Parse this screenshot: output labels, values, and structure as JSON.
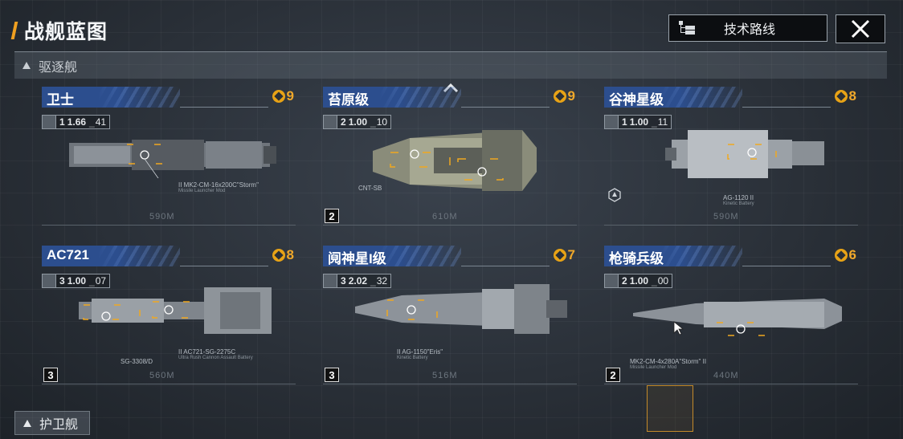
{
  "header": {
    "title": "战舰蓝图",
    "tech_route_label": "技术路线"
  },
  "sections": {
    "destroyer_label": "驱逐舰",
    "escort_label": "护卫舰"
  },
  "ships": [
    {
      "name": "卫士",
      "cost": "9",
      "type_num": "1",
      "stat_main": "1.66",
      "stat_sub": "41",
      "speed": "590M",
      "level": "",
      "weapon": "II  MK2-CM-16x200C\"Storm\"",
      "weapon_sub": "Missile Launcher Mod"
    },
    {
      "name": "苔原级",
      "cost": "9",
      "type_num": "2",
      "stat_main": "1.00",
      "stat_sub": "10",
      "speed": "610M",
      "level": "2",
      "weapon": "CNT-SB",
      "weapon_sub": ""
    },
    {
      "name": "谷神星级",
      "cost": "8",
      "type_num": "1",
      "stat_main": "1.00",
      "stat_sub": "11",
      "speed": "590M",
      "level": "",
      "weapon": "AG-1120 II",
      "weapon_sub": "Kinetic Battery"
    },
    {
      "name": "AC721",
      "cost": "8",
      "type_num": "3",
      "stat_main": "1.00",
      "stat_sub": "07",
      "speed": "560M",
      "level": "3",
      "weapon": "II  AC721-SG-2275C",
      "weapon_sub": "Ultra Rush Cannon Assault Battery",
      "weapon2": "SG-3308/D"
    },
    {
      "name": "阋神星I级",
      "cost": "7",
      "type_num": "3",
      "stat_main": "2.02",
      "stat_sub": "32",
      "speed": "516M",
      "level": "3",
      "weapon": "II  AG-1150\"Eris\"",
      "weapon_sub": "Kinetic Battery"
    },
    {
      "name": "枪骑兵级",
      "cost": "6",
      "type_num": "2",
      "stat_main": "1.00",
      "stat_sub": "00",
      "speed": "440M",
      "level": "2",
      "weapon": "MK2-CM-4x280A\"Storm\" II",
      "weapon_sub": "Missile Launcher Mod"
    }
  ],
  "colors": {
    "accent": "#f0a820",
    "name_bar": "#2c4e8e",
    "cost": "#f0a82a"
  }
}
